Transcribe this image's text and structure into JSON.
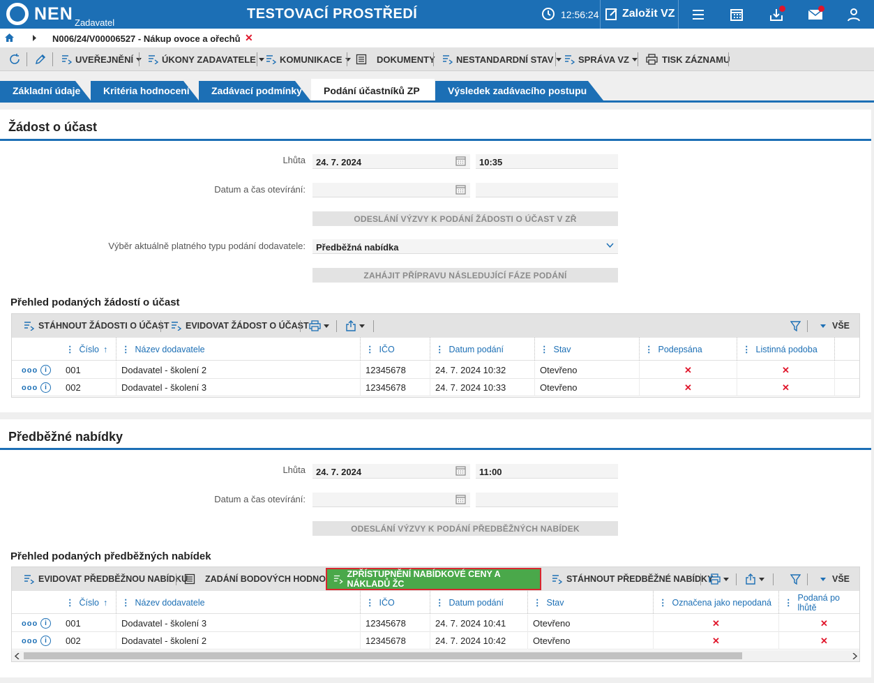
{
  "header": {
    "logo": "NEN",
    "logo_sub": "Zadavatel",
    "environment": "TESTOVACÍ PROSTŘEDÍ",
    "time": "12:56:24",
    "new_vz": "Založit VZ"
  },
  "breadcrumb": {
    "record": "N006/24/V00006527 - Nákup ovoce a ořechů"
  },
  "toolbar": {
    "publish": "UVEŘEJNĚNÍ",
    "acts": "ÚKONY ZADAVATELE",
    "communication": "KOMUNIKACE",
    "documents": "DOKUMENTY",
    "nonstandard": "NESTANDARDNÍ STAV",
    "manage": "SPRÁVA VZ",
    "print": "TISK ZÁZNAMU"
  },
  "tabs": [
    {
      "label": "Základní údaje"
    },
    {
      "label": "Kritéria hodnocení"
    },
    {
      "label": "Zadávací podmínky"
    },
    {
      "label": "Podání účastníků ZP"
    },
    {
      "label": "Výsledek zadávacího postupu"
    }
  ],
  "section1": {
    "title": "Žádost o účast",
    "deadline_label": "Lhůta",
    "deadline_date": "24. 7. 2024",
    "deadline_time": "10:35",
    "opening_label": "Datum a čas otevírání:",
    "send_button": "ODESLÁNÍ VÝZVY K PODÁNÍ ŽÁDOSTI O ÚČAST V ZŘ",
    "type_label": "Výběr aktuálně platného typu podání dodavatele:",
    "type_value": "Předběžná nabídka",
    "start_button": "ZAHÁJIT PŘÍPRAVU NÁSLEDUJÍCÍ FÁZE PODÁNÍ",
    "grid_title": "Přehled podaných žádostí o účast",
    "grid_toolbar": {
      "download": "STÁHNOUT ŽÁDOSTI O ÚČAST",
      "record": "EVIDOVAT ŽÁDOST O ÚČAST",
      "all": "VŠE"
    },
    "columns": [
      "Číslo",
      "Název dodavatele",
      "IČO",
      "Datum podání",
      "Stav",
      "Podepsána",
      "Listinná podoba"
    ],
    "rows": [
      {
        "num": "001",
        "name": "Dodavatel - školení 2",
        "ico": "12345678",
        "date": "24. 7. 2024 10:32",
        "state": "Otevřeno",
        "signed": "✕",
        "paper": "✕"
      },
      {
        "num": "002",
        "name": "Dodavatel - školení 3",
        "ico": "12345678",
        "date": "24. 7. 2024 10:33",
        "state": "Otevřeno",
        "signed": "✕",
        "paper": "✕"
      }
    ]
  },
  "section2": {
    "title": "Předběžné nabídky",
    "deadline_label": "Lhůta",
    "deadline_date": "24. 7. 2024",
    "deadline_time": "11:00",
    "opening_label": "Datum a čas otevírání:",
    "send_button": "ODESLÁNÍ VÝZVY K PODÁNÍ PŘEDBĚŽNÝCH NABÍDEK",
    "grid_title": "Přehled podaných předběžných nabídek",
    "grid_toolbar": {
      "record": "EVIDOVAT PŘEDBĚŽNOU NABÍDKU",
      "points": "ZADÁNÍ BODOVÝCH HODNOT",
      "disclose": "ZPŘÍSTUPNĚNÍ NABÍDKOVÉ CENY A NÁKLADŮ ŽC",
      "download": "STÁHNOUT PŘEDBĚŽNÉ NABÍDKY",
      "all": "VŠE"
    },
    "columns": [
      "Číslo",
      "Název dodavatele",
      "IČO",
      "Datum podání",
      "Stav",
      "Označena jako nepodaná",
      "Podaná po lhůtě"
    ],
    "rows": [
      {
        "num": "001",
        "name": "Dodavatel - školení 3",
        "ico": "12345678",
        "date": "24. 7. 2024 10:41",
        "state": "Otevřeno",
        "unsubmitted": "✕",
        "late": "✕"
      },
      {
        "num": "002",
        "name": "Dodavatel - školení 2",
        "ico": "12345678",
        "date": "24. 7. 2024 10:42",
        "state": "Otevřeno",
        "unsubmitted": "✕",
        "late": "✕"
      }
    ]
  }
}
